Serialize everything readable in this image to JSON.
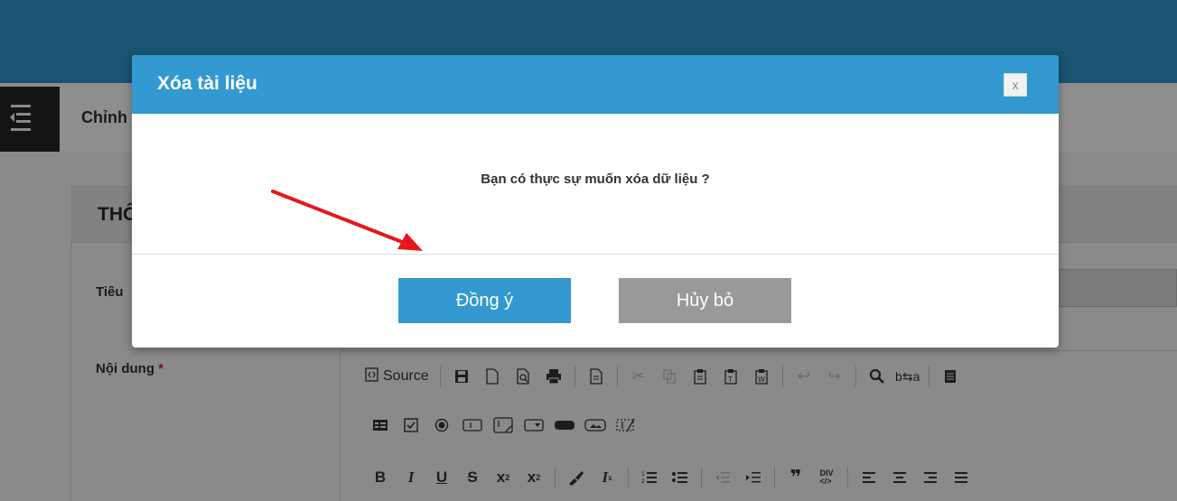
{
  "background": {
    "breadcrumb": "Chỉnh",
    "panel_title": "THÔ",
    "field_title_label": "Tiêu",
    "field_content_label": "Nội dung",
    "required_mark": "*",
    "source_label": "Source"
  },
  "modal": {
    "title": "Xóa tài liệu",
    "close_label": "x",
    "message": "Bạn có thực sự muốn xóa dữ liệu ?",
    "confirm_label": "Đồng ý",
    "cancel_label": "Hủy bỏ"
  },
  "colors": {
    "header_blue": "#3399d0",
    "topbar": "#195470",
    "cancel_gray": "#999999",
    "annotation_arrow": "#e8161b"
  },
  "icons": {
    "toolbar_row1": [
      "source-icon",
      "save-icon",
      "new-page-icon",
      "preview-icon",
      "print-icon",
      "templates-icon",
      "cut-icon",
      "copy-icon",
      "paste-icon",
      "paste-text-icon",
      "paste-word-icon",
      "undo-icon",
      "redo-icon",
      "find-icon",
      "replace-icon",
      "select-all-icon"
    ],
    "toolbar_row2": [
      "form-icon",
      "checkbox-icon",
      "radio-icon",
      "textfield-icon",
      "textarea-icon",
      "select-icon",
      "button-icon",
      "imagebutton-icon",
      "hiddenfield-icon"
    ],
    "toolbar_row3": [
      "bold-icon",
      "italic-icon",
      "underline-icon",
      "strike-icon",
      "subscript-icon",
      "superscript-icon",
      "copy-format-icon",
      "remove-format-icon",
      "numbered-list-icon",
      "bulleted-list-icon",
      "outdent-icon",
      "indent-icon",
      "blockquote-icon",
      "div-icon",
      "align-left-icon",
      "align-center-icon",
      "align-right-icon",
      "justify-icon"
    ]
  }
}
